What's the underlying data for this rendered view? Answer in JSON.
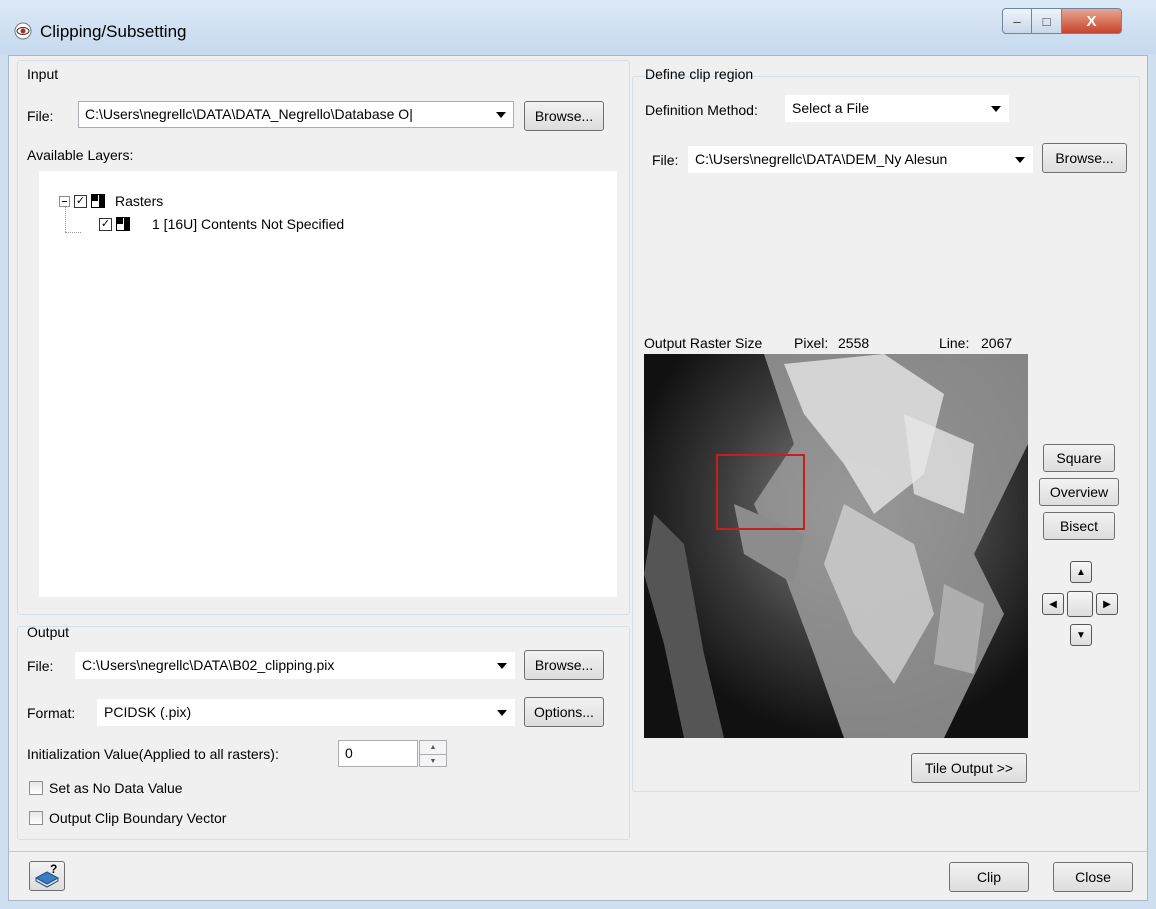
{
  "window": {
    "title": "Clipping/Subsetting",
    "controls": {
      "minimize": "–",
      "maximize": "□",
      "close": "X"
    }
  },
  "input": {
    "group_title": "Input",
    "file_label": "File:",
    "file_value": "C:\\Users\\negrellc\\DATA\\DATA_Negrello\\Database O|",
    "browse_label": "Browse...",
    "layers_label": "Available Layers:",
    "tree": {
      "root_label": "Rasters",
      "child_label": "1 [16U] Contents Not Specified"
    }
  },
  "output": {
    "group_title": "Output",
    "file_label": "File:",
    "file_value": "C:\\Users\\negrellc\\DATA\\B02_clipping.pix",
    "browse_label": "Browse...",
    "format_label": "Format:",
    "format_value": "PCIDSK (.pix)",
    "options_label": "Options...",
    "init_label": "Initialization Value(Applied to all rasters):",
    "init_value": "0",
    "nodata_label": "Set as No Data Value",
    "boundary_label": "Output Clip Boundary Vector"
  },
  "clip_region": {
    "group_title": "Define clip region",
    "method_label": "Definition Method:",
    "method_value": "Select a File",
    "file_label": "File:",
    "file_value": "C:\\Users\\negrellc\\DATA\\DEM_Ny Alesun",
    "browse_label": "Browse...",
    "size_label": "Output Raster Size",
    "pixel_label": "Pixel:",
    "pixel_value": "2558",
    "line_label": "Line:",
    "line_value": "2067",
    "square_label": "Square",
    "overview_label": "Overview",
    "bisect_label": "Bisect",
    "tile_label": "Tile Output >>"
  },
  "footer": {
    "clip_label": "Clip",
    "close_label": "Close"
  },
  "colors": {
    "clip_rectangle": "#c81e1e",
    "title_close": "#c7432b"
  }
}
